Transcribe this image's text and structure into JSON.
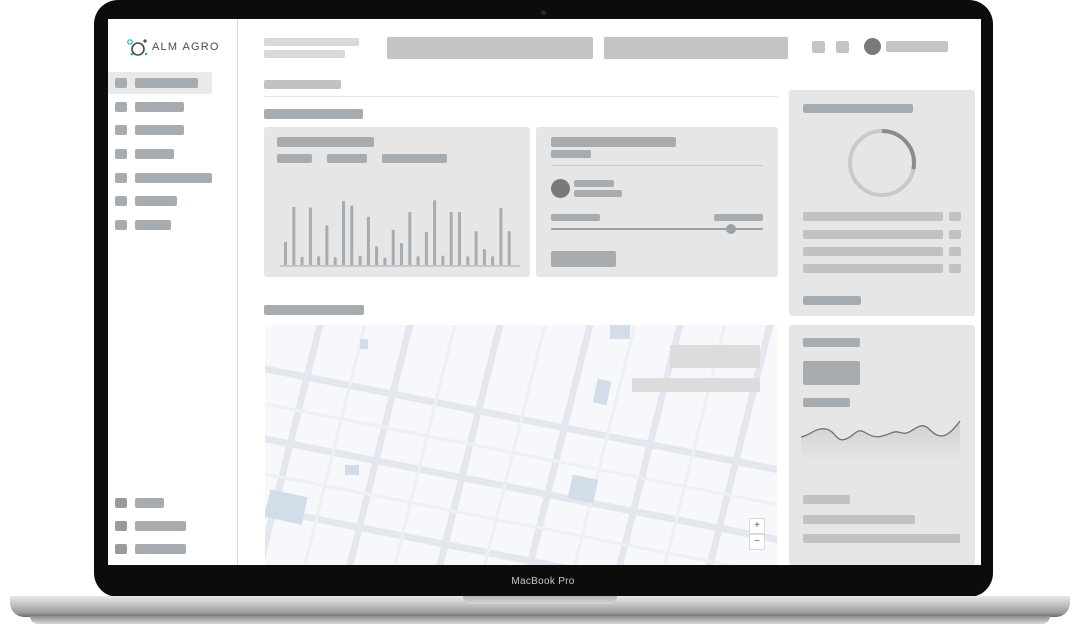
{
  "device": {
    "label": "MacBook Pro"
  },
  "brand": {
    "logo_text": "ALM AGRO",
    "accent": "#2bb3b8",
    "dark": "#4a4a4a"
  },
  "colors": {
    "skeleton_blue": "#a6acb0",
    "skeleton_gray": "#c2c2c2",
    "panel": "#e6e6e6",
    "map_bg": "#f6f8fb"
  },
  "nav": {
    "items": 7,
    "footer_items": 3
  },
  "bar_chart": {
    "values": [
      0.35,
      0.88,
      0.12,
      0.87,
      0.13,
      0.6,
      0.12,
      0.97,
      0.9,
      0.14,
      0.73,
      0.28,
      0.11,
      0.53,
      0.33,
      0.8,
      0.13,
      0.5,
      0.98,
      0.14,
      0.8,
      0.8,
      0.13,
      0.51,
      0.24,
      0.13,
      0.86,
      0.51
    ]
  },
  "slider": {
    "value": 0.85
  },
  "donut": {
    "fraction": 0.28
  },
  "map": {
    "zoom_in": "+",
    "zoom_out": "−"
  }
}
